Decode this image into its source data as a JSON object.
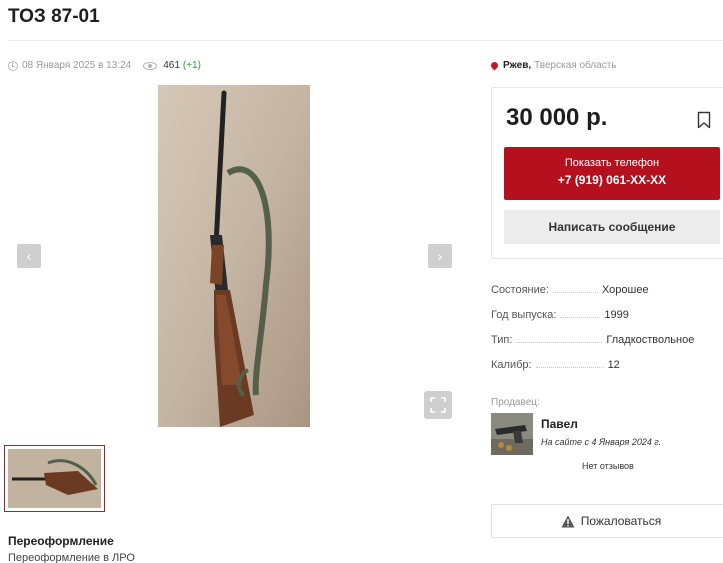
{
  "listing": {
    "title": "ТОЗ 87-01",
    "date": "08 Января 2025 в 13:24",
    "views": "461",
    "views_delta": "(+1)"
  },
  "gallery": {
    "prev_label": "‹",
    "next_label": "›"
  },
  "location": {
    "city": "Ржев,",
    "region": "Тверская область"
  },
  "price_card": {
    "price": "30 000 р.",
    "phone_label": "Показать телефон",
    "phone_number": "+7 (919) 061-XX-XX",
    "message_label": "Написать сообщение"
  },
  "specs": [
    {
      "label": "Состояние:",
      "value": "Хорошее"
    },
    {
      "label": "Год выпуска:",
      "value": "1999"
    },
    {
      "label": "Тип:",
      "value": "Гладкоствольное"
    },
    {
      "label": "Калибр:",
      "value": "12"
    }
  ],
  "seller": {
    "label": "Продавец:",
    "name": "Павел",
    "since": "На сайте с 4 Января 2024 г.",
    "reviews": "Нет отзывов"
  },
  "report_label": "Пожаловаться",
  "description": {
    "title": "Переоформление",
    "text": "Переоформление в ЛРО"
  },
  "colors": {
    "accent": "#b5101e",
    "muted": "#9a9a9a",
    "positive": "#2e9c3c"
  }
}
